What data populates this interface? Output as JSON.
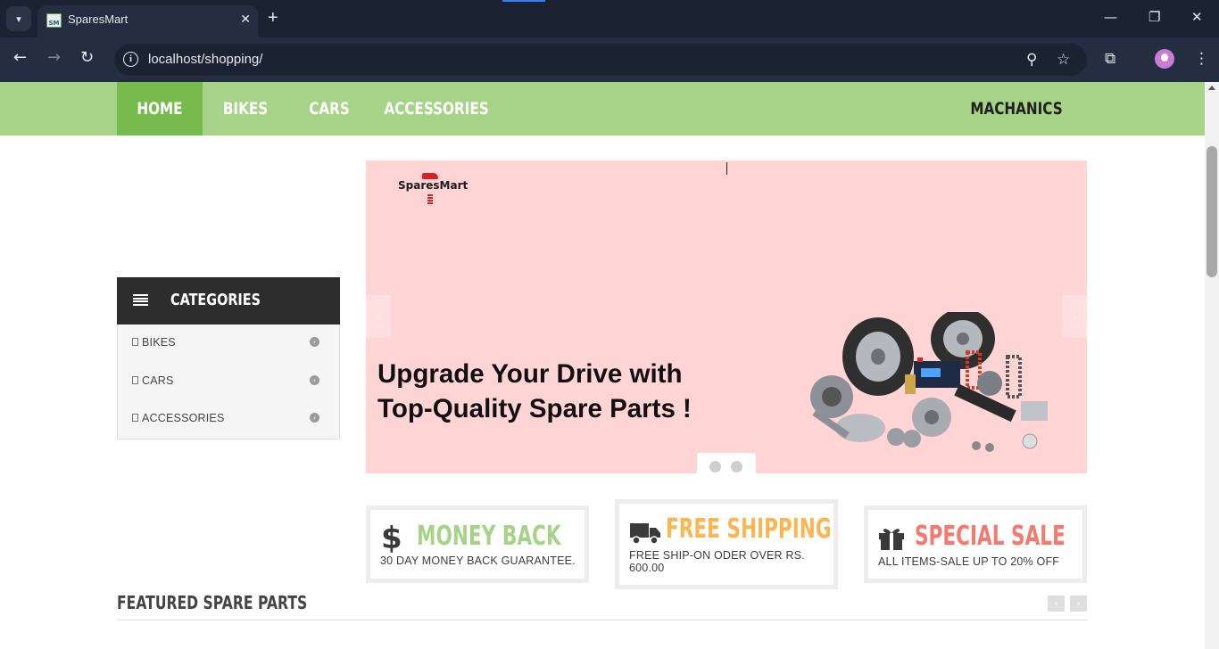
{
  "browser": {
    "tab_title": "SparesMart",
    "favicon_text": "SM",
    "url": "localhost/shopping/",
    "icons": [
      "tab-list-icon",
      "close-icon",
      "new-tab-icon",
      "minimize-icon",
      "restore-icon",
      "window-close-icon",
      "back-icon",
      "forward-icon",
      "reload-icon",
      "site-info-icon",
      "zoom-icon",
      "bookmark-star-icon",
      "extensions-icon",
      "profile-avatar",
      "menu-kebab-icon"
    ]
  },
  "nav": {
    "items": [
      "HOME",
      "BIKES",
      "CARS",
      "ACCESSORIES"
    ],
    "right_item": "MACHANICS",
    "bar_color": "#a6d387",
    "active_color": "#77bb4e"
  },
  "categories": {
    "title": "CATEGORIES",
    "items": [
      "BIKES",
      "CARS",
      "ACCESSORIES"
    ]
  },
  "slider": {
    "logo": "SparesMart",
    "headline_line1": "Upgrade Your Drive with",
    "headline_line2": "Top-Quality Spare Parts !",
    "background": "#ffd4d4",
    "dots": 2
  },
  "features": [
    {
      "icon": "dollar-icon",
      "title": "MONEY BACK",
      "desc": "30 DAY MONEY BACK GUARANTEE.",
      "color": "#a6d387"
    },
    {
      "icon": "truck-icon",
      "title": "FREE SHIPPING",
      "desc": "FREE SHIP-ON ODER OVER RS. 600.00",
      "color": "#fbb654"
    },
    {
      "icon": "gift-icon",
      "title": "SPECIAL SALE",
      "desc": "ALL ITEMS-SALE UP TO 20% OFF",
      "color": "#f27a6e"
    }
  ],
  "featured": {
    "title": "FEATURED SPARE PARTS"
  }
}
